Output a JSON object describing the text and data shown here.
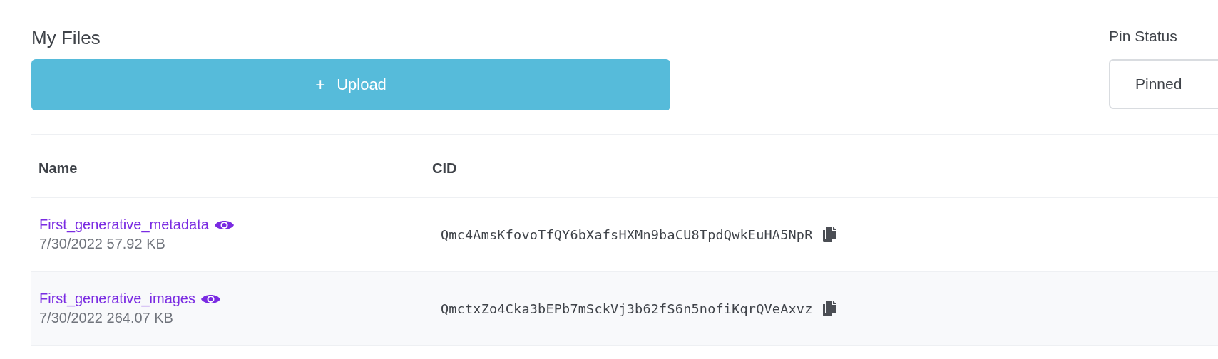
{
  "title": "My Files",
  "upload_button": {
    "icon": "+",
    "label": "Upload"
  },
  "pin_status": {
    "label": "Pin Status",
    "value": "Pinned"
  },
  "table": {
    "columns": [
      "Name",
      "CID"
    ],
    "rows": [
      {
        "name": "First_generative_metadata",
        "meta": "7/30/2022 57.92 KB",
        "cid": "Qmc4AmsKfovoTfQY6bXafsHXMn9baCU8TpdQwkEuHA5NpR"
      },
      {
        "name": "First_generative_images",
        "meta": "7/30/2022 264.07 KB",
        "cid": "QmctxZo4Cka3bEPb7mSckVj3b62fS6n5nofiKqrQVeAxvz"
      }
    ]
  }
}
